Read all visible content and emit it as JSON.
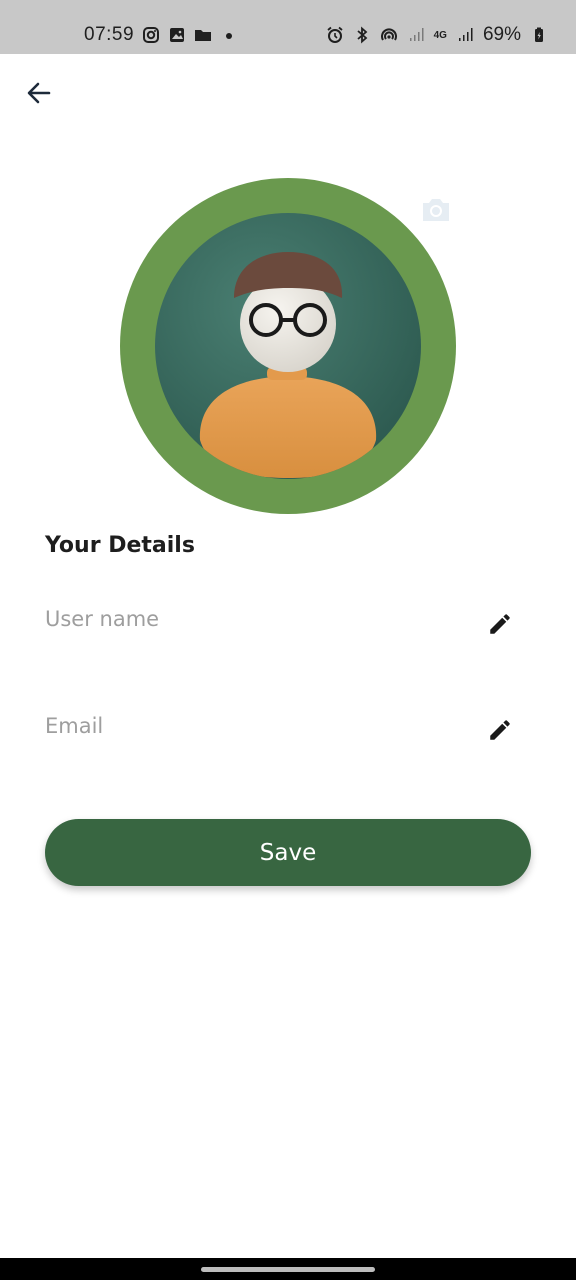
{
  "status_bar": {
    "time": "07:59",
    "network_type": "4G",
    "battery": "69%",
    "left_icons": [
      "instagram-icon",
      "gallery-icon",
      "folder-icon",
      "dot-icon"
    ],
    "right_icons": [
      "alarm-icon",
      "bluetooth-icon",
      "hotspot-icon",
      "signal-icon",
      "battery-icon"
    ]
  },
  "nav": {
    "back_icon": "arrow-left-icon"
  },
  "profile": {
    "camera_icon": "camera-icon",
    "ring_color": "#6a994e",
    "inner_color": "#3a6b60"
  },
  "details": {
    "title": "Your Details",
    "username": {
      "value": "",
      "placeholder": "User name",
      "edit_icon": "pencil-icon"
    },
    "email": {
      "value": "",
      "placeholder": "Email",
      "edit_icon": "pencil-icon"
    }
  },
  "actions": {
    "save_label": "Save"
  },
  "colors": {
    "primary": "#386641",
    "accent": "#6a994e",
    "text": "#1e1e1e",
    "placeholder": "#9e9e9e"
  }
}
